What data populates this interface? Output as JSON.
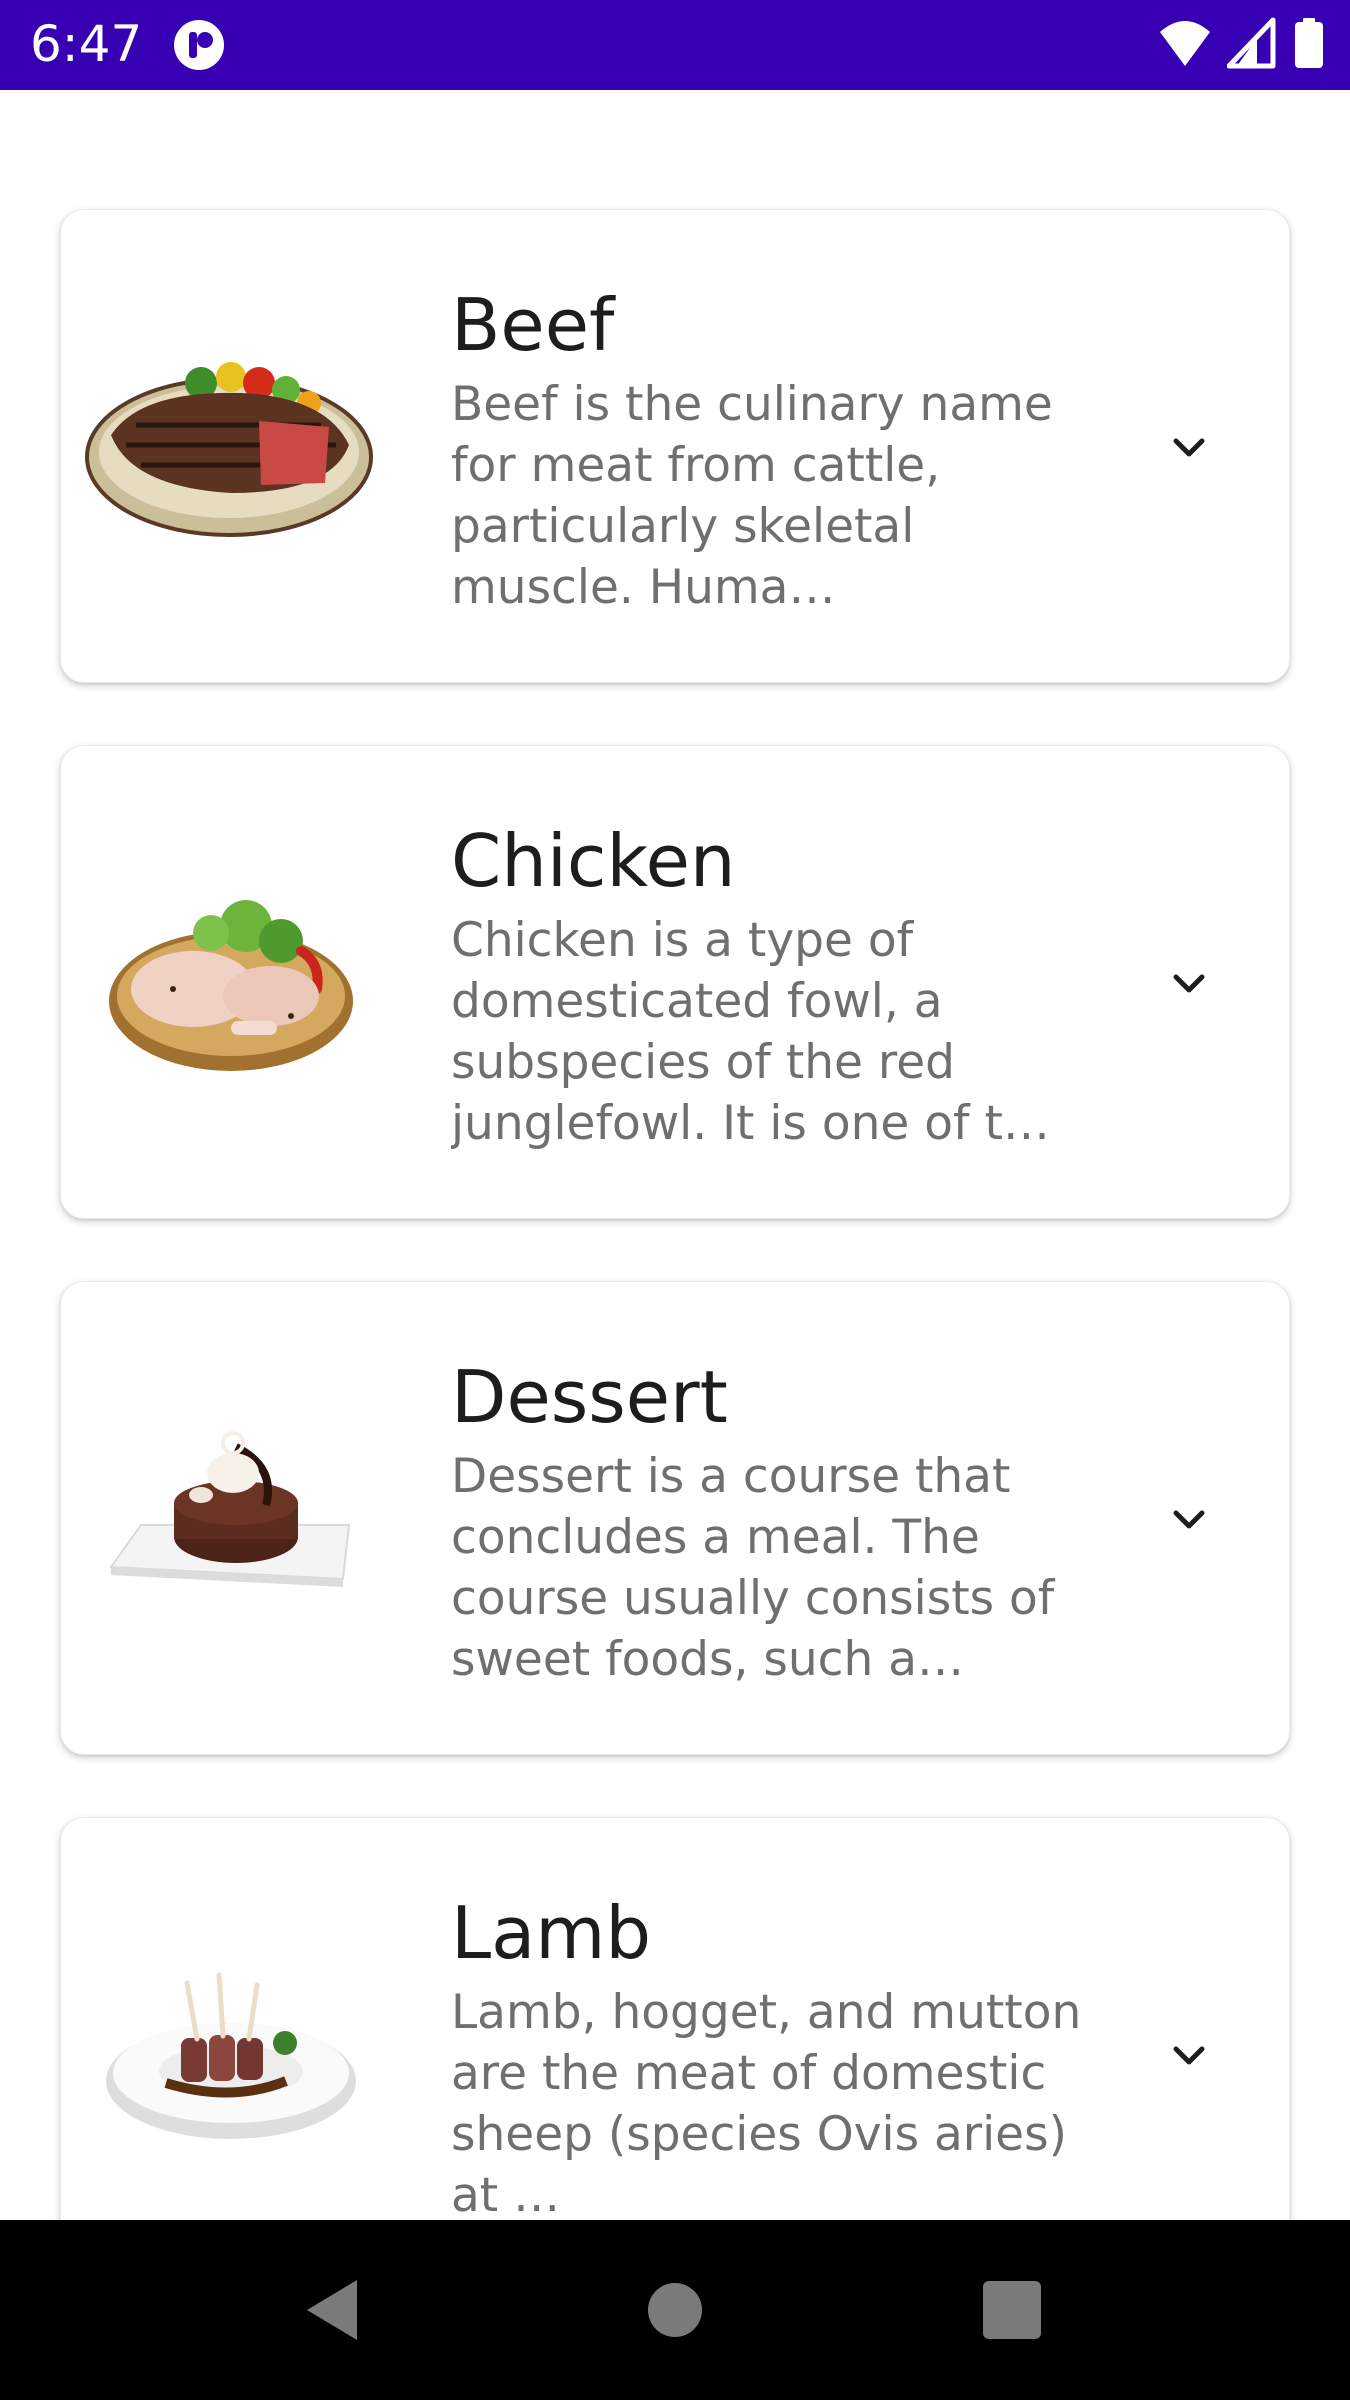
{
  "status_bar": {
    "time": "6:47",
    "background": "#3700b3",
    "icons": [
      "app-notification-icon",
      "wifi-icon",
      "signal-icon",
      "battery-icon"
    ]
  },
  "categories": [
    {
      "title": "Beef",
      "description": "Beef is the culinary name for meat from cattle, particularly skeletal muscle. Huma…",
      "image": "beef-steak-plate",
      "expand_icon": "chevron-down-icon"
    },
    {
      "title": "Chicken",
      "description": "Chicken is a type of domesticated fowl, a subspecies of the red junglefowl. It is one of t…",
      "image": "chicken-legs-board",
      "expand_icon": "chevron-down-icon"
    },
    {
      "title": "Dessert",
      "description": "Dessert is a course that concludes a meal. The course usually consists of sweet foods, such a…",
      "image": "chocolate-cake-plate",
      "expand_icon": "chevron-down-icon"
    },
    {
      "title": "Lamb",
      "description": "Lamb, hogget, and mutton are the meat of domestic sheep (species Ovis aries) at …",
      "image": "lamb-chops-plate",
      "expand_icon": "chevron-down-icon"
    }
  ],
  "navigation_bar": {
    "buttons": [
      "back-icon",
      "home-icon",
      "recents-icon"
    ]
  }
}
